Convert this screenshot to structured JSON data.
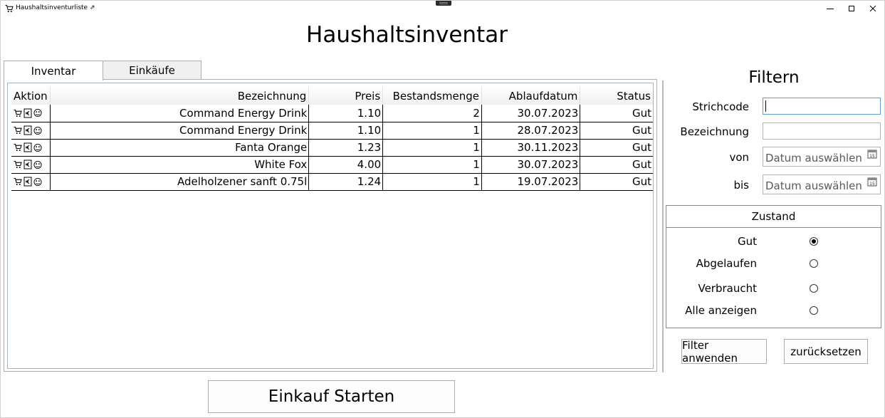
{
  "window": {
    "title": "Haushaltsinventurliste",
    "title_suffix": "⇗"
  },
  "header": {
    "title": "Haushaltsinventar"
  },
  "tabs": [
    {
      "label": "Inventar",
      "active": true
    },
    {
      "label": "Einkäufe",
      "active": false
    }
  ],
  "grid": {
    "columns": [
      "Aktion",
      "Bezeichnung",
      "Preis",
      "Bestandsmenge",
      "Ablaufdatum",
      "Status"
    ],
    "rows": [
      {
        "bezeichnung": "Command Energy Drink",
        "preis": "1.10",
        "menge": "2",
        "datum": "30.07.2023",
        "status": "Gut"
      },
      {
        "bezeichnung": "Command Energy Drink",
        "preis": "1.10",
        "menge": "1",
        "datum": "28.07.2023",
        "status": "Gut"
      },
      {
        "bezeichnung": "Fanta Orange",
        "preis": "1.23",
        "menge": "1",
        "datum": "30.11.2023",
        "status": "Gut"
      },
      {
        "bezeichnung": "White Fox",
        "preis": "4.00",
        "menge": "1",
        "datum": "30.07.2023",
        "status": "Gut"
      },
      {
        "bezeichnung": "Adelholzener sanft 0.75l",
        "preis": "1.24",
        "menge": "1",
        "datum": "19.07.2023",
        "status": "Gut"
      }
    ],
    "action_icons": [
      "cart-icon",
      "euro-receipt-icon",
      "consume-icon"
    ]
  },
  "filter": {
    "title": "Filtern",
    "strichcode_label": "Strichcode",
    "bezeichnung_label": "Bezeichnung",
    "von_label": "von",
    "bis_label": "bis",
    "date_placeholder": "Datum auswählen",
    "zustand": {
      "title": "Zustand",
      "options": [
        {
          "label": "Gut",
          "checked": true
        },
        {
          "label": "Abgelaufen",
          "checked": false
        },
        {
          "label": "Verbraucht",
          "checked": false
        },
        {
          "label": "Alle anzeigen",
          "checked": false
        }
      ]
    },
    "apply_label": "Filter anwenden",
    "reset_label": "zurücksetzen"
  },
  "footer": {
    "start_label": "Einkauf Starten"
  },
  "colors": {
    "focus_border": "#5aa0e0",
    "frame_border": "#a0b4c8"
  }
}
